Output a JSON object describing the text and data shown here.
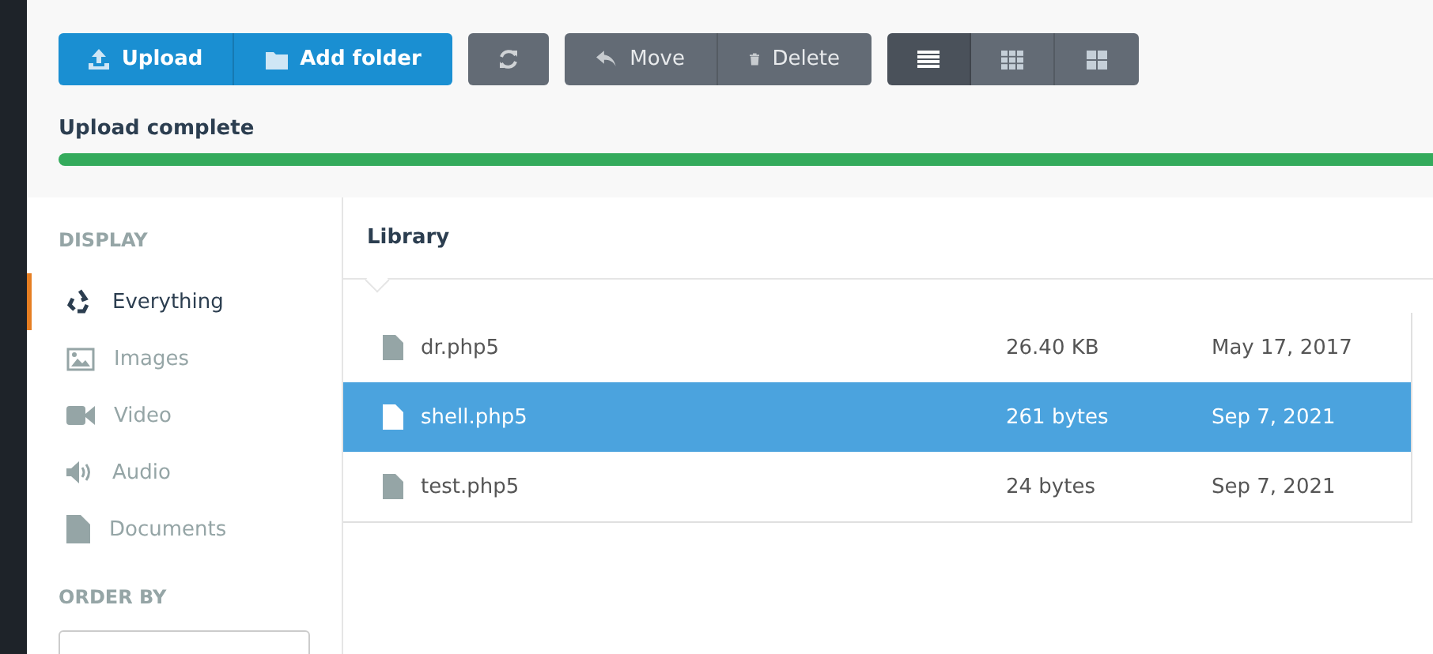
{
  "toolbar": {
    "groups": [
      {
        "buttons": [
          {
            "kind": "upload",
            "label": "Upload"
          },
          {
            "kind": "folder",
            "label": "Add folder"
          }
        ],
        "color": "#1a8fd2"
      },
      {
        "buttons": [
          {
            "kind": "refresh"
          }
        ],
        "color": "#636b75"
      },
      {
        "buttons": [
          {
            "kind": "move",
            "label": "Move"
          },
          {
            "kind": "delete",
            "label": "Delete"
          }
        ],
        "color": "#636b75"
      }
    ],
    "views": [
      {
        "kind": "list",
        "selected": true
      },
      {
        "kind": "grid",
        "selected": false
      },
      {
        "kind": "tiles",
        "selected": false
      }
    ]
  },
  "upload": {
    "status": "Upload complete",
    "level": 1
  },
  "sidebar": {
    "display_heading": "DISPLAY",
    "items": [
      {
        "kind": "everything",
        "label": "Everything",
        "selected": true
      },
      {
        "kind": "images",
        "label": "Images",
        "selected": false
      },
      {
        "kind": "video",
        "label": "Video",
        "selected": false
      },
      {
        "kind": "audio",
        "label": "Audio",
        "selected": false
      },
      {
        "kind": "documents",
        "label": "Documents",
        "selected": false
      }
    ],
    "order_heading": "ORDER BY"
  },
  "library": {
    "title": "Library",
    "rows": [
      {
        "name": "dr.php5",
        "size": "26.40 KB",
        "date": "May 17, 2017",
        "selected": false
      },
      {
        "name": "shell.php5",
        "size": "261 bytes",
        "date": "Sep 7, 2021",
        "selected": true
      },
      {
        "name": "test.php5",
        "size": "24 bytes",
        "date": "Sep 7, 2021",
        "selected": false
      }
    ]
  }
}
